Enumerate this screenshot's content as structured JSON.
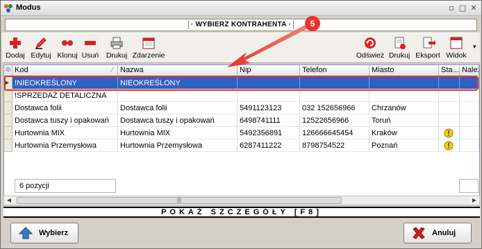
{
  "window": {
    "title": "Modus",
    "min": "▫",
    "max": "□",
    "close": "✕"
  },
  "dialog": {
    "title": "WYBIERZ KONTRAHENTA"
  },
  "annotation": {
    "number": "5"
  },
  "toolbar": {
    "dodaj": "Dodaj",
    "edytuj": "Edytuj",
    "klonuj": "Klonuj",
    "usun": "Usuń",
    "drukuj": "Drukuj",
    "zdarzenie": "Zdarzenie",
    "odswiez": "Odśwież",
    "drukuj2": "Drukuj",
    "eksport": "Eksport",
    "widok": "Widok"
  },
  "grid": {
    "headers": {
      "kod": "Kod",
      "nazwa": "Nazwa",
      "nip": "Nip",
      "telefon": "Telefon",
      "miasto": "Miasto",
      "status": "Sta...",
      "nalez": "Należ"
    },
    "rows": [
      {
        "kod": "!NIEOKREŚLONY",
        "nazwa": "NIEOKREŚLONY",
        "nip": "",
        "telefon": "",
        "miasto": "",
        "status": ""
      },
      {
        "kod": "!SPRZEDAŻ DETALICZNA",
        "nazwa": "",
        "nip": "",
        "telefon": "",
        "miasto": "",
        "status": ""
      },
      {
        "kod": "Dostawca folii",
        "nazwa": "Dostawca folii",
        "nip": "5491123123",
        "telefon": "032 152656966",
        "miasto": "Chrzanów",
        "status": ""
      },
      {
        "kod": "Dostawca tuszy i opakowań",
        "nazwa": "Dostawca tuszy i opakowań",
        "nip": "6498741111",
        "telefon": "12522656966",
        "miasto": "Toruń",
        "status": ""
      },
      {
        "kod": "Hurtownia MIX",
        "nazwa": "Hurtownia MIX",
        "nip": "5492356891",
        "telefon": "126666645454",
        "miasto": "Kraków",
        "status": "warn"
      },
      {
        "kod": "Hurtownia Przemysłowa",
        "nazwa": "Hurtownia Przemysłowa",
        "nip": "6287411222",
        "telefon": "8798754522",
        "miasto": "Poznań",
        "status": "warn"
      }
    ],
    "count": "6 pozycji"
  },
  "details": "POKAŻ SZCZEGÓŁY [F8]",
  "buttons": {
    "wybierz": "Wybierz",
    "anuluj": "Anuluj"
  },
  "colors": {
    "selection": "#3060c0",
    "annotation": "#e8322c"
  }
}
